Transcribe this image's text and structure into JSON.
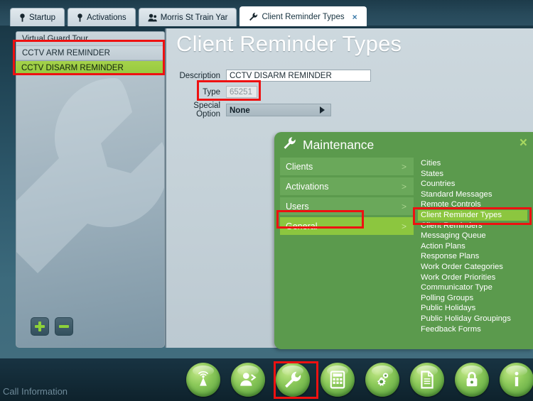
{
  "window": {
    "call_information": "Call Information"
  },
  "tabs": [
    {
      "label": "Startup",
      "icon": "pin-icon",
      "active": false
    },
    {
      "label": "Activations",
      "icon": "pin-icon",
      "active": false
    },
    {
      "label": "Morris St Train Yar",
      "icon": "people-icon",
      "active": false
    },
    {
      "label": "Client Reminder Types",
      "icon": "wrench-icon",
      "active": true,
      "close": "×"
    }
  ],
  "list_panel": {
    "items": [
      {
        "label": "Virtual Guard Tour",
        "selected": false
      },
      {
        "label": "CCTV ARM REMINDER",
        "selected": false
      },
      {
        "label": "CCTV DISARM REMINDER",
        "selected": true
      }
    ],
    "add_button": "+",
    "remove_button": "−"
  },
  "main": {
    "title": "Client Reminder Types",
    "fields": {
      "description_label": "Description",
      "description_value": "CCTV DISARM REMINDER",
      "type_label": "Type",
      "type_value": "65251",
      "special_option_label": "Special Option",
      "special_option_value": "None"
    },
    "buttons": {
      "save": "save-icon",
      "cancel": "cancel-icon"
    }
  },
  "maintenance": {
    "title": "Maintenance",
    "icon": "wrench-icon",
    "close": "×",
    "categories": [
      {
        "label": "Clients",
        "chevron": ">",
        "active": false
      },
      {
        "label": "Activations",
        "chevron": ">",
        "active": false
      },
      {
        "label": "Users",
        "chevron": ">",
        "active": false
      },
      {
        "label": "General",
        "chevron": ">",
        "active": true
      }
    ],
    "items": [
      {
        "label": "Cities",
        "active": false
      },
      {
        "label": "States",
        "active": false
      },
      {
        "label": "Countries",
        "active": false
      },
      {
        "label": "Standard Messages",
        "active": false
      },
      {
        "label": "Remote Controls",
        "active": false
      },
      {
        "label": "Client Reminder Types",
        "active": true
      },
      {
        "label": "Client Reminders",
        "active": false
      },
      {
        "label": "Messaging Queue",
        "active": false
      },
      {
        "label": "Action Plans",
        "active": false
      },
      {
        "label": "Response Plans",
        "active": false
      },
      {
        "label": "Work Order Categories",
        "active": false
      },
      {
        "label": "Work Order Priorities",
        "active": false
      },
      {
        "label": "Communicator Type",
        "active": false
      },
      {
        "label": "Polling Groups",
        "active": false
      },
      {
        "label": "Public Holidays",
        "active": false
      },
      {
        "label": "Public Holiday Groupings",
        "active": false
      },
      {
        "label": "Feedback Forms",
        "active": false
      }
    ]
  },
  "dock": [
    {
      "name": "antenna-icon"
    },
    {
      "name": "add-user-icon"
    },
    {
      "name": "wrench-icon",
      "highlighted": true
    },
    {
      "name": "calculator-icon"
    },
    {
      "name": "gears-icon"
    },
    {
      "name": "document-icon"
    },
    {
      "name": "lock-icon"
    },
    {
      "name": "info-icon"
    }
  ],
  "colors": {
    "accent_green": "#8cc63f",
    "panel_green": "#5b9a4d",
    "menu_green": "#6aa85a",
    "annotation_red": "#ee1111",
    "content_bg": "#c5d2d8"
  }
}
